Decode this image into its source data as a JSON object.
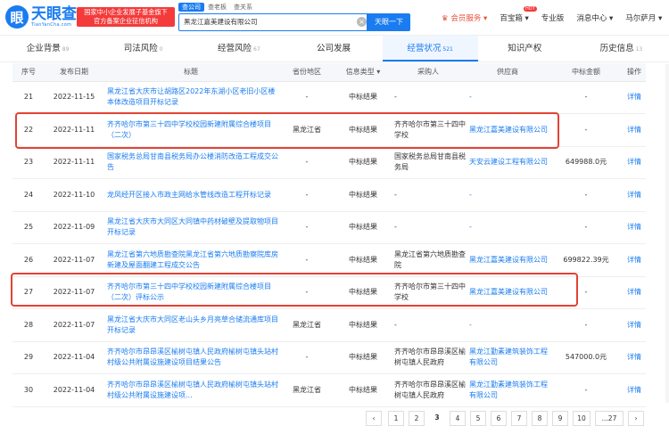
{
  "header": {
    "logo_mark": "眼",
    "logo_name": "天眼查",
    "logo_sub": "TianYanCha.com",
    "gov_badge_line1": "国家中小企业发展子基金旗下",
    "gov_badge_line2": "官方备案企业征信机构",
    "search_tabs": [
      "查公司",
      "查老板",
      "查关系"
    ],
    "search_value": "黑龙江嘉美建设有限公司",
    "search_button": "天眼一下",
    "nav": {
      "vip": "会员服务",
      "box": "百宝箱",
      "box_badge": "HOT",
      "pro": "专业版",
      "msg": "消息中心",
      "user": "马尔萨月"
    }
  },
  "tabs": [
    {
      "label": "企业背景",
      "count": "89"
    },
    {
      "label": "司法风险",
      "count": "0"
    },
    {
      "label": "经营风险",
      "count": "67"
    },
    {
      "label": "公司发展",
      "count": ""
    },
    {
      "label": "经营状况",
      "count": "521"
    },
    {
      "label": "知识产权",
      "count": ""
    },
    {
      "label": "历史信息",
      "count": "13"
    }
  ],
  "table": {
    "headers": [
      "序号",
      "发布日期",
      "标题",
      "省份地区",
      "信息类型",
      "采购人",
      "供应商",
      "中标金额",
      "操作"
    ],
    "rows": [
      {
        "no": "21",
        "date": "2022-11-15",
        "title": "黑龙江省大庆市让胡路区2022年东湖小区老旧小区楼本体改造项目开标记录",
        "region": "-",
        "type": "中标结果",
        "buyer": "-",
        "supplier": "-",
        "amount": "-",
        "op": "详情"
      },
      {
        "no": "22",
        "date": "2022-11-11",
        "title": "齐齐哈尔市第三十四中学校校园新建附属综合楼项目（二次）",
        "region": "黑龙江省",
        "type": "中标结果",
        "buyer": "齐齐哈尔市第三十四中学校",
        "supplier": "黑龙江嘉美建设有限公司",
        "amount": "-",
        "op": "详情"
      },
      {
        "no": "23",
        "date": "2022-11-11",
        "title": "国家税务总局甘南县税务局办公楼消防改造工程成交公告",
        "region": "-",
        "type": "中标结果",
        "buyer": "国家税务总局甘南县税务局",
        "supplier": "天安云建设工程有限公司",
        "amount": "649988.0元",
        "op": "详情"
      },
      {
        "no": "24",
        "date": "2022-11-10",
        "title": "龙凤经开区接入市政主网给水管线改造工程开标记录",
        "region": "-",
        "type": "中标结果",
        "buyer": "-",
        "supplier": "-",
        "amount": "-",
        "op": "详情"
      },
      {
        "no": "25",
        "date": "2022-11-09",
        "title": "黑龙江省大庆市大同区大同镇中药材破壁及提取物项目开标记录",
        "region": "-",
        "type": "中标结果",
        "buyer": "-",
        "supplier": "-",
        "amount": "-",
        "op": "详情"
      },
      {
        "no": "26",
        "date": "2022-11-07",
        "title": "黑龙江省第六地质勘查院黑龙江省第六地质勘察院库房新建及屋面翻建工程成交公告",
        "region": "-",
        "type": "中标结果",
        "buyer": "黑龙江省第六地质勘查院",
        "supplier": "黑龙江嘉美建设有限公司",
        "amount": "699822.39元",
        "op": "详情"
      },
      {
        "no": "27",
        "date": "2022-11-07",
        "title": "齐齐哈尔市第三十四中学校校园新建附属综合楼项目（二次）评标公示",
        "region": "-",
        "type": "中标结果",
        "buyer": "齐齐哈尔市第三十四中学校",
        "supplier": "黑龙江嘉美建设有限公司",
        "amount": "-",
        "op": "详情"
      },
      {
        "no": "28",
        "date": "2022-11-07",
        "title": "黑龙江省大庆市大同区老山头乡月亮草合储流通库项目开标记录",
        "region": "黑龙江省",
        "type": "中标结果",
        "buyer": "-",
        "supplier": "-",
        "amount": "-",
        "op": "详情"
      },
      {
        "no": "29",
        "date": "2022-11-04",
        "title": "齐齐哈尔市昂昂溪区榆树屯镇人民政府榆树屯镇头站村村级公共附属设施建设项目结果公告",
        "region": "-",
        "type": "中标结果",
        "buyer": "齐齐哈尔市昂昂溪区榆树屯镇人民政府",
        "supplier": "黑龙江勤素建筑装饰工程有限公司",
        "amount": "547000.0元",
        "op": "详情"
      },
      {
        "no": "30",
        "date": "2022-11-04",
        "title": "齐齐哈尔市昂昂溪区榆树屯镇人民政府榆树屯镇头站村村级公共附属设施建设项...",
        "region": "黑龙江省",
        "type": "中标结果",
        "buyer": "齐齐哈尔市昂昂溪区榆树屯镇人民政府",
        "supplier": "黑龙江勤素建筑装饰工程有限公司",
        "amount": "-",
        "op": "详情"
      }
    ]
  },
  "pagination": {
    "prev": "‹",
    "pages": [
      "1",
      "2",
      "3",
      "4",
      "5",
      "6",
      "7",
      "8",
      "9",
      "10",
      "...27"
    ],
    "current": "3",
    "next": "›"
  },
  "colors": {
    "accent": "#1a7cf0",
    "highlight": "#e34234"
  }
}
